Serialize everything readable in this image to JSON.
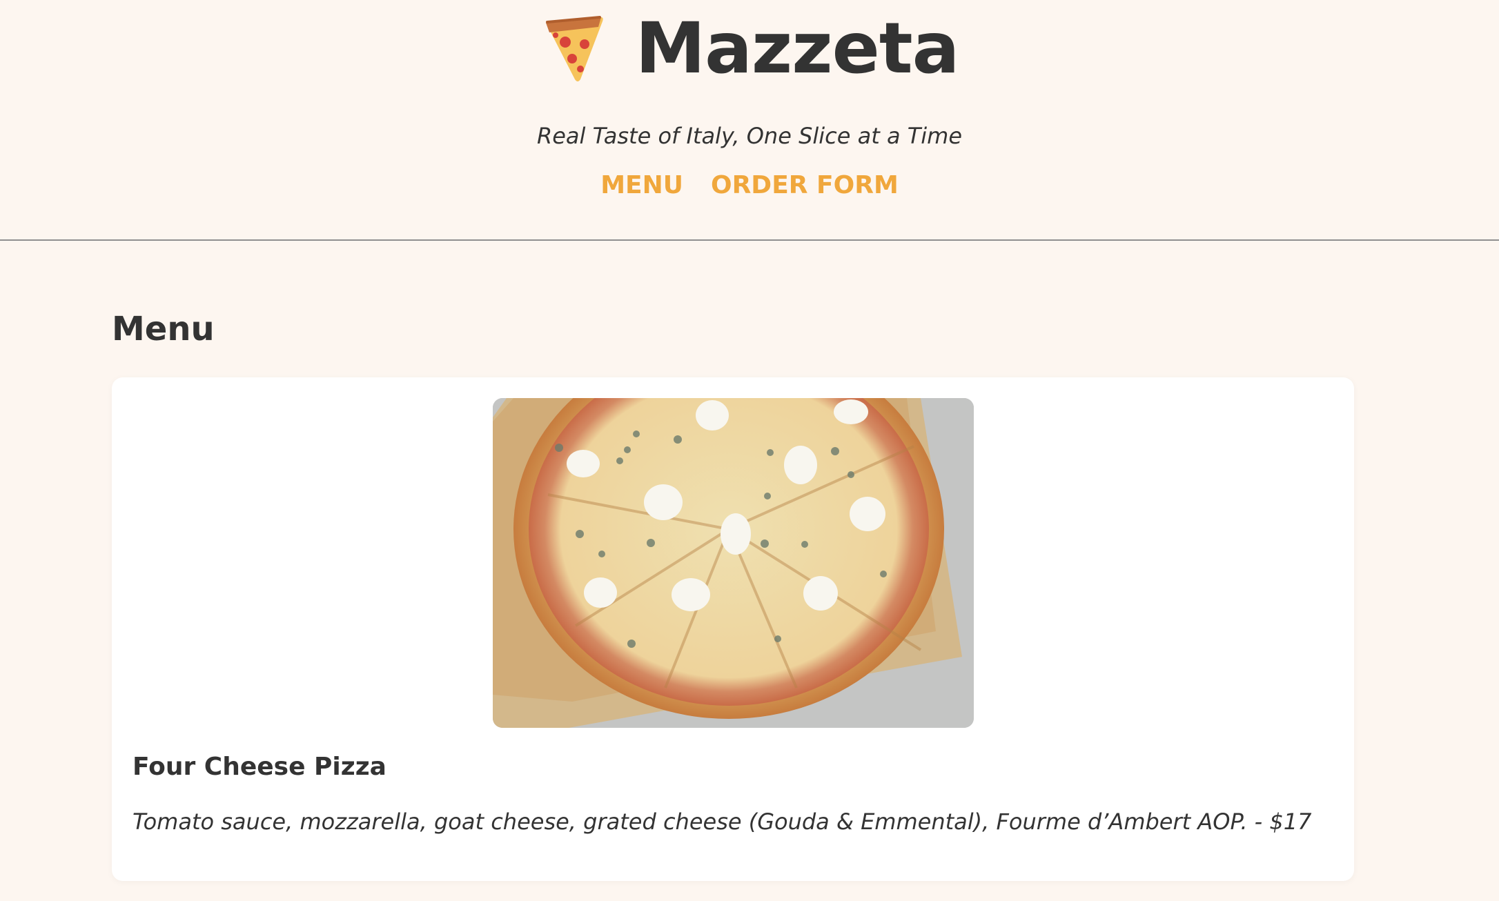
{
  "header": {
    "logo_icon": "pizza-slice-icon",
    "title": "Mazzeta",
    "tagline": "Real Taste of Italy, One Slice at a Time",
    "nav": [
      {
        "label": "MENU"
      },
      {
        "label": "ORDER FORM"
      }
    ],
    "accent_color": "#f0a73c"
  },
  "main": {
    "section_title": "Menu",
    "items": [
      {
        "name": "Four Cheese Pizza",
        "description": "Tomato sauce, mozzarella, goat cheese, grated cheese (Gouda & Emmental), Fourme d’Ambert AOP. - $17"
      }
    ]
  }
}
